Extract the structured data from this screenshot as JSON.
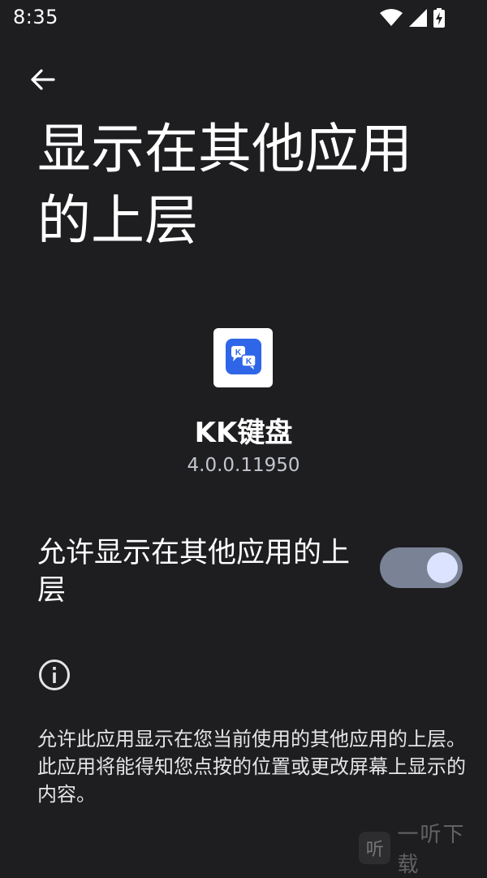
{
  "status_bar": {
    "time": "8:35",
    "icons": [
      "wifi-icon",
      "cellular-signal-icon",
      "battery-charging-icon"
    ]
  },
  "header": {
    "back_icon": "arrow-left-icon",
    "title": "显示在其他应用的上层"
  },
  "app": {
    "icon": "kk-keyboard-app-icon",
    "icon_text": "KK",
    "icon_color": "#2f66e8",
    "name": "KK键盘",
    "version": "4.0.0.11950"
  },
  "permission": {
    "label": "允许显示在其他应用的上层",
    "enabled": true,
    "toggle_track_color": "#7a8295",
    "toggle_thumb_color": "#dbe3ff"
  },
  "info": {
    "icon": "info-icon",
    "description": "允许此应用显示在您当前使用的其他应用的上层。此应用将能得知您点按的位置或更改屏幕上显示的内容。"
  },
  "watermark": {
    "logo_char": "听",
    "text": "一听下载"
  },
  "colors": {
    "background": "#1e1e20",
    "text_primary": "#ffffff",
    "text_secondary": "#c3c6cf"
  }
}
